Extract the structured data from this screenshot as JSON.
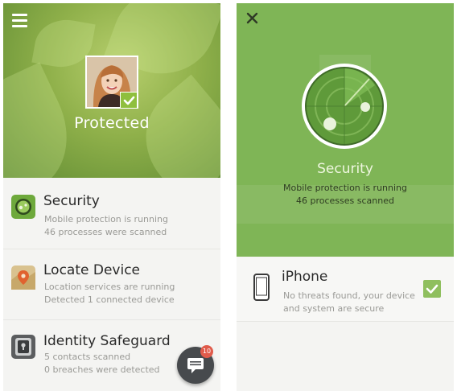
{
  "left": {
    "status_label": "Protected",
    "items": [
      {
        "title": "Security",
        "line1": "Mobile protection is running",
        "line2": "46 processes were scanned",
        "icon": "security-icon"
      },
      {
        "title": "Locate Device",
        "line1": "Location services are running",
        "line2": "Detected 1 connected device",
        "icon": "map-pin-icon"
      },
      {
        "title": "Identity Safeguard",
        "line1": "5 contacts scanned",
        "line2": "0 breaches were detected",
        "icon": "vault-icon"
      }
    ],
    "fab_badge": "10"
  },
  "right": {
    "title": "Security",
    "line1": "Mobile protection is running",
    "line2": "46 processes scanned",
    "device": {
      "name": "iPhone",
      "line1": "No threats found, your device",
      "line2": "and system are secure"
    }
  },
  "colors": {
    "brand_green": "#7fb556",
    "check_green": "#8fbf5e",
    "badge_red": "#e05b4b"
  }
}
